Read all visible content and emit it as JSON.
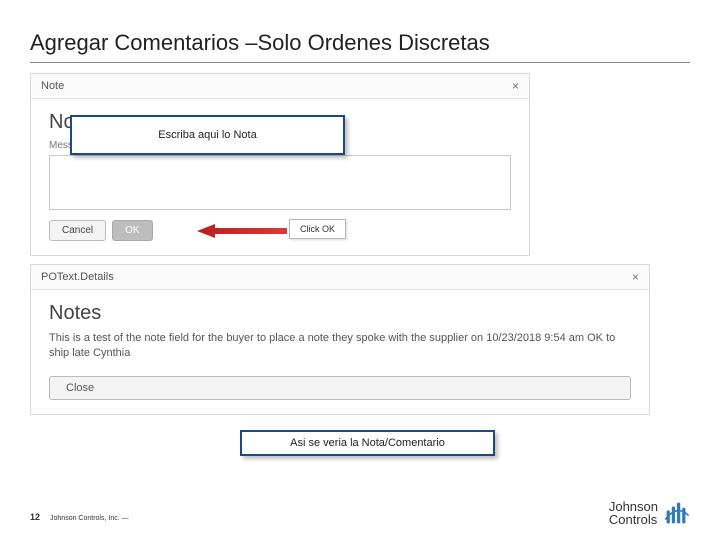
{
  "slide": {
    "title": "Agregar Comentarios –Solo Ordenes Discretas"
  },
  "panel1": {
    "header": "Note",
    "heading": "Notes",
    "messageLabel": "Message:",
    "overlayHint": "Escriba aqui lo Nota",
    "cancel": "Cancel",
    "ok": "OK",
    "clickHint": "Click OK"
  },
  "panel2": {
    "header": "POText.Details",
    "heading": "Notes",
    "sample": "This is a test of the note field for the buyer to place a note they spoke with the supplier on 10/23/2018 9:54 am OK to ship late Cynthia",
    "close": "Close",
    "overlayHint": "Asi se veria la Nota/Comentario"
  },
  "footer": {
    "page": "12",
    "copyright": "Johnson Controls, Inc. —"
  },
  "logo": {
    "line1": "Johnson",
    "line2": "Controls"
  }
}
